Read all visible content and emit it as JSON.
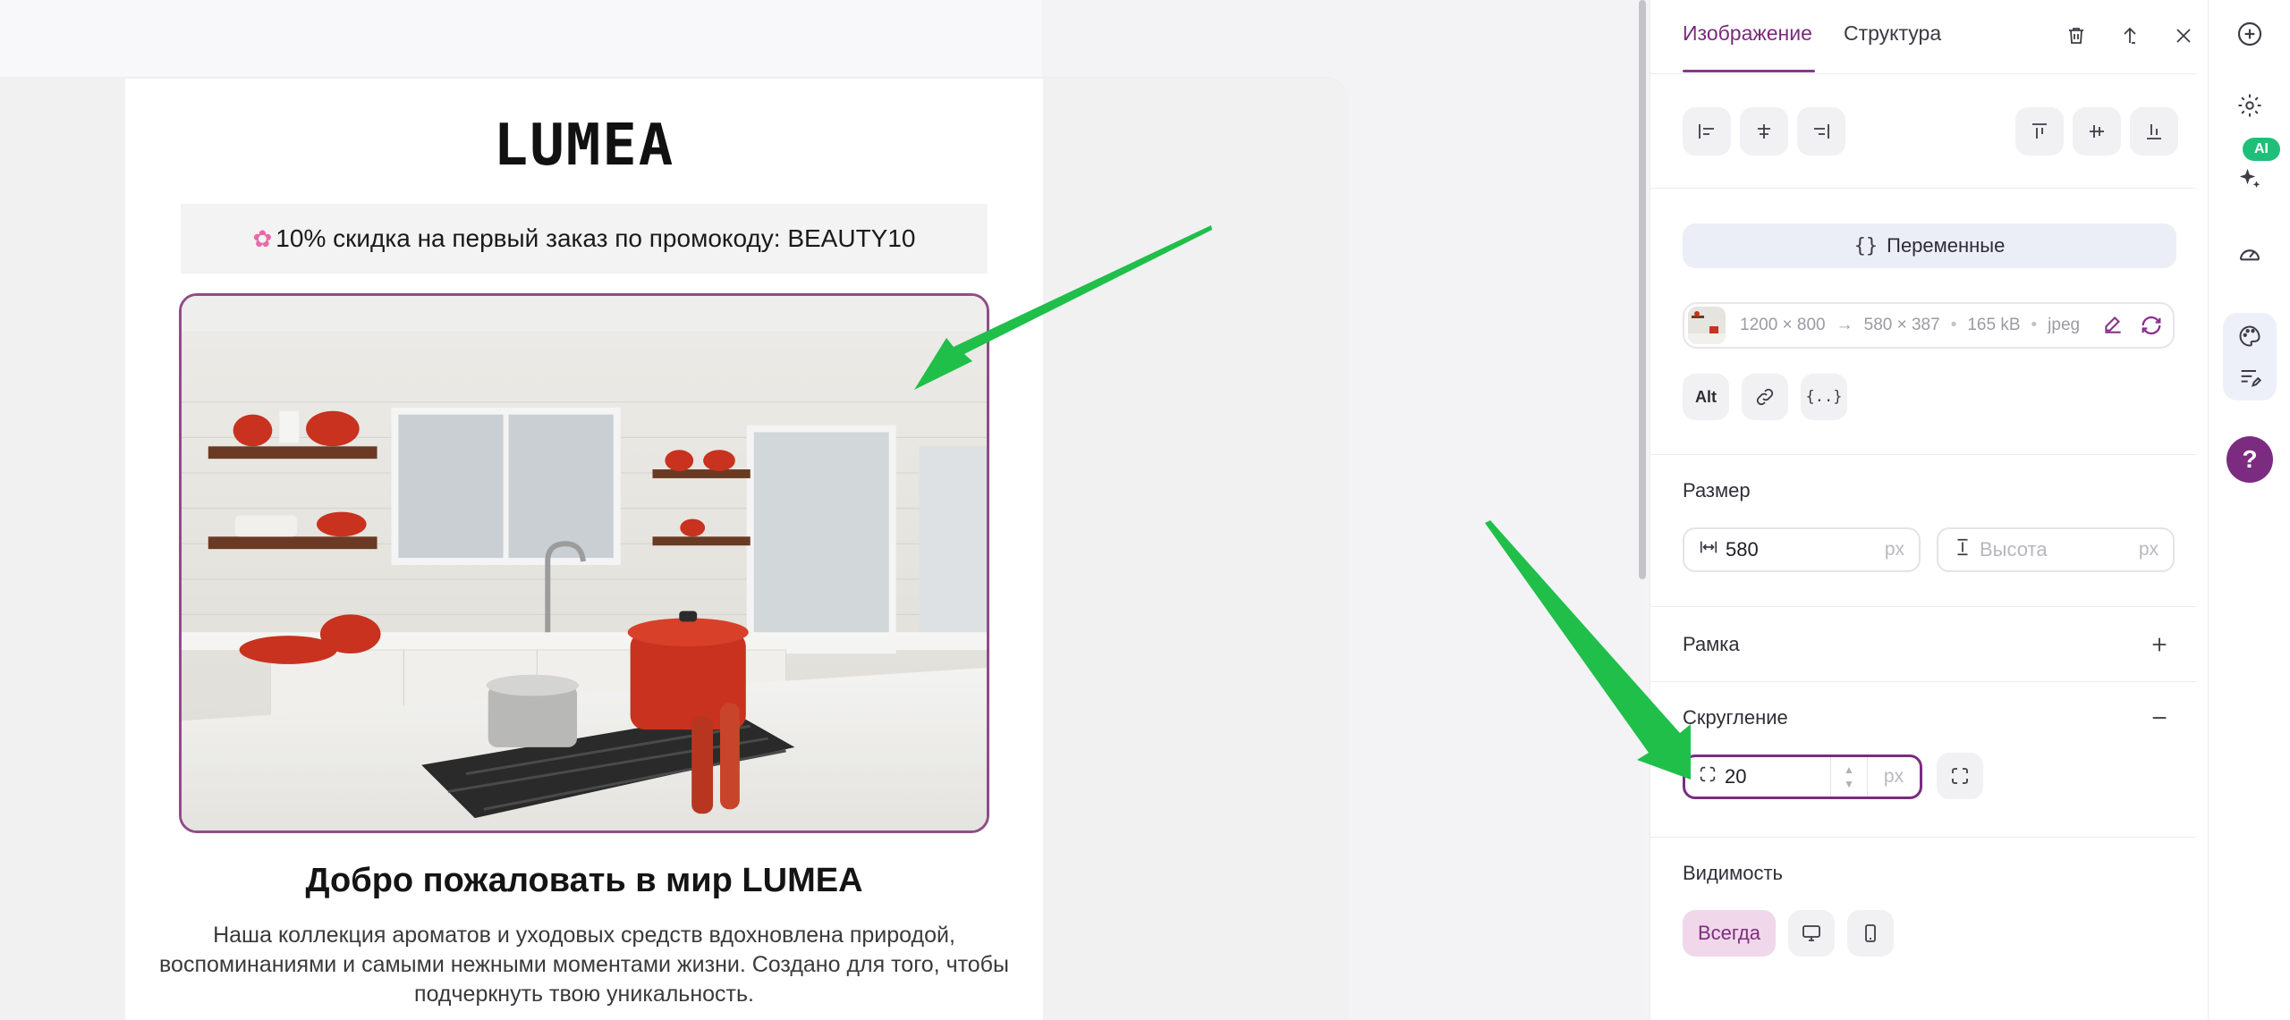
{
  "email": {
    "logo": "LUMEA",
    "promo_icon": "flower-emoji",
    "promo_text": "10% скидка на первый заказ по промокоду: BEAUTY10",
    "hero_image": "kitchen-photo",
    "title": "Добро пожаловать в мир LUMEA",
    "text": "Наша коллекция ароматов и уходовых средств вдохновлена природой, воспоминаниями и самыми нежными моментами жизни. Создано для того, чтобы подчеркнуть твою уникальность."
  },
  "panel": {
    "tabs": [
      {
        "label": "Изображение",
        "active": true
      },
      {
        "label": "Структура",
        "active": false
      }
    ],
    "header_icons": [
      "trash-icon",
      "move-up-icon",
      "close-icon"
    ],
    "align_icons": [
      "align-left-icon",
      "align-center-horizontal-icon",
      "align-right-icon",
      "align-top-icon",
      "align-middle-vertical-icon",
      "align-bottom-icon"
    ],
    "variables_label": "Переменные",
    "image_info": {
      "original": "1200 × 800",
      "arrow": "→",
      "resized": "580 × 387",
      "size": "165 kB",
      "format": "jpeg"
    },
    "alt_label": "Alt",
    "size": {
      "label": "Размер",
      "width_value": "580",
      "width_unit": "px",
      "height_placeholder": "Высота",
      "height_unit": "px"
    },
    "border": {
      "label": "Рамка"
    },
    "radius": {
      "label": "Скругление",
      "value": "20",
      "unit": "px"
    },
    "visibility": {
      "label": "Видимость",
      "always_label": "Всегда"
    }
  },
  "rail": {
    "ai_badge": "AI",
    "help": "?"
  },
  "colors": {
    "accent": "#7b2c80",
    "annotation_arrow": "#1fbf4a",
    "ai_badge": "#1fbf7a"
  }
}
